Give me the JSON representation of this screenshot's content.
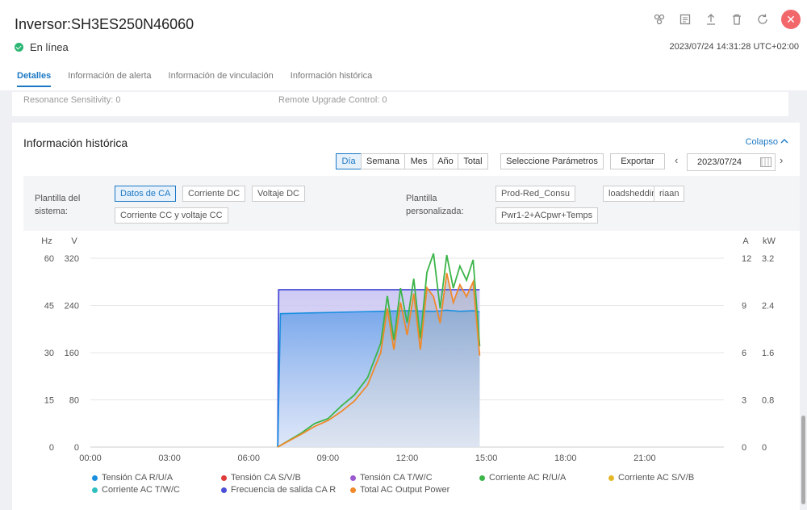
{
  "header": {
    "title": "Inversor:SH3ES250N46060",
    "status": "En línea",
    "timestamp": "2023/07/24 14:31:28 UTC+02:00",
    "tabs": [
      {
        "label": "Detalles",
        "active": true
      },
      {
        "label": "Información de alerta"
      },
      {
        "label": "Información de vinculación"
      },
      {
        "label": "Información histórica"
      }
    ]
  },
  "prev_section": {
    "left_text": "Resonance Sensitivity:  0",
    "right_text": "Remote Upgrade Control:  0"
  },
  "history": {
    "title": "Información histórica",
    "collapse_label": "Colapso",
    "period_buttons": [
      "Día",
      "Semana",
      "Mes",
      "Año",
      "Total"
    ],
    "active_period": "Día",
    "select_params": "Seleccione Parámetros",
    "export": "Exportar",
    "date": "2023/07/24",
    "system_template_label_1": "Plantilla del",
    "system_template_label_2": "sistema:",
    "system_templates": [
      "Datos de CA",
      "Corriente DC",
      "Voltaje DC",
      "Corriente CC y voltaje CC"
    ],
    "custom_template_label_1": "Plantilla",
    "custom_template_label_2": "personalizada:",
    "custom_templates": [
      "Prod-Red_Consu",
      "loadshedding",
      "riaan",
      "Pwr1-2+ACpwr+Temps"
    ]
  },
  "chart_data": {
    "type": "line",
    "axis_units": {
      "left_outer": "Hz",
      "left_inner": "V",
      "right_inner": "A",
      "right_outer": "kW"
    },
    "x_ticks": [
      "00:00",
      "03:00",
      "06:00",
      "09:00",
      "12:00",
      "15:00",
      "18:00",
      "21:00"
    ],
    "y_ticks_hz": [
      "0",
      "15",
      "30",
      "45",
      "60"
    ],
    "y_ticks_v": [
      "0",
      "80",
      "160",
      "240",
      "320"
    ],
    "y_ticks_a": [
      "0",
      "3",
      "6",
      "9",
      "12"
    ],
    "y_ticks_kw": [
      "0",
      "0.8",
      "1.6",
      "2.4",
      "3.2"
    ],
    "ylim_v": [
      0,
      320
    ],
    "ylim_a": [
      0,
      12
    ],
    "ylim_hz": [
      0,
      60
    ],
    "ylim_kw": [
      0,
      3.2
    ],
    "xlim_hours": [
      0,
      24
    ],
    "series": [
      {
        "name": "Tensión CA R/U/A",
        "color": "#1a8fe0",
        "axis": "v",
        "x": [
          "07:06",
          "07:12",
          "08:00",
          "09:00",
          "10:00",
          "11:00",
          "12:00",
          "13:00",
          "13:30",
          "14:00",
          "14:30",
          "14:45"
        ],
        "y": [
          0,
          226,
          227,
          228,
          229,
          230,
          231,
          230,
          232,
          230,
          231,
          229
        ]
      },
      {
        "name": "Tensión CA S/V/B",
        "color": "#e03a3a",
        "axis": "v",
        "x": [],
        "y": []
      },
      {
        "name": "Tensión CA T/W/C",
        "color": "#9b59d0",
        "axis": "v",
        "x": [],
        "y": []
      },
      {
        "name": "Corriente AC R/U/A",
        "color": "#3cb54a",
        "axis": "a",
        "x": [
          "07:06",
          "07:30",
          "08:00",
          "08:30",
          "09:00",
          "09:30",
          "10:00",
          "10:30",
          "11:00",
          "11:15",
          "11:30",
          "11:45",
          "12:00",
          "12:15",
          "12:30",
          "12:45",
          "13:00",
          "13:15",
          "13:30",
          "13:45",
          "14:00",
          "14:15",
          "14:30",
          "14:45"
        ],
        "y": [
          0,
          0.4,
          0.9,
          1.5,
          1.8,
          2.6,
          3.3,
          4.4,
          6.6,
          9.6,
          6.8,
          10.1,
          7.9,
          10.7,
          6.9,
          11.1,
          12.3,
          8.8,
          12.2,
          10.1,
          11.5,
          10.6,
          11.9,
          6.4
        ]
      },
      {
        "name": "Corriente AC S/V/B",
        "color": "#e5b82a",
        "axis": "a",
        "x": [],
        "y": []
      },
      {
        "name": "Corriente AC T/W/C",
        "color": "#2fbfbf",
        "axis": "a",
        "x": [],
        "y": []
      },
      {
        "name": "Frecuencia de salida CA R",
        "color": "#4b4fd6",
        "axis": "hz",
        "x": [
          "07:06",
          "07:08",
          "14:45"
        ],
        "y": [
          0,
          50,
          50
        ]
      },
      {
        "name": "Total AC Output Power",
        "color": "#f0892a",
        "axis": "kw",
        "x": [
          "07:06",
          "07:30",
          "08:00",
          "08:30",
          "09:00",
          "09:30",
          "10:00",
          "10:30",
          "11:00",
          "11:15",
          "11:30",
          "11:45",
          "12:00",
          "12:15",
          "12:30",
          "12:45",
          "13:00",
          "13:15",
          "13:30",
          "13:45",
          "14:00",
          "14:15",
          "14:30",
          "14:45"
        ],
        "y": [
          0,
          0.1,
          0.22,
          0.35,
          0.45,
          0.6,
          0.78,
          1.05,
          1.6,
          2.35,
          1.65,
          2.45,
          1.9,
          2.6,
          1.65,
          2.7,
          2.55,
          2.1,
          2.95,
          2.45,
          2.75,
          2.55,
          2.8,
          1.55
        ]
      }
    ]
  }
}
